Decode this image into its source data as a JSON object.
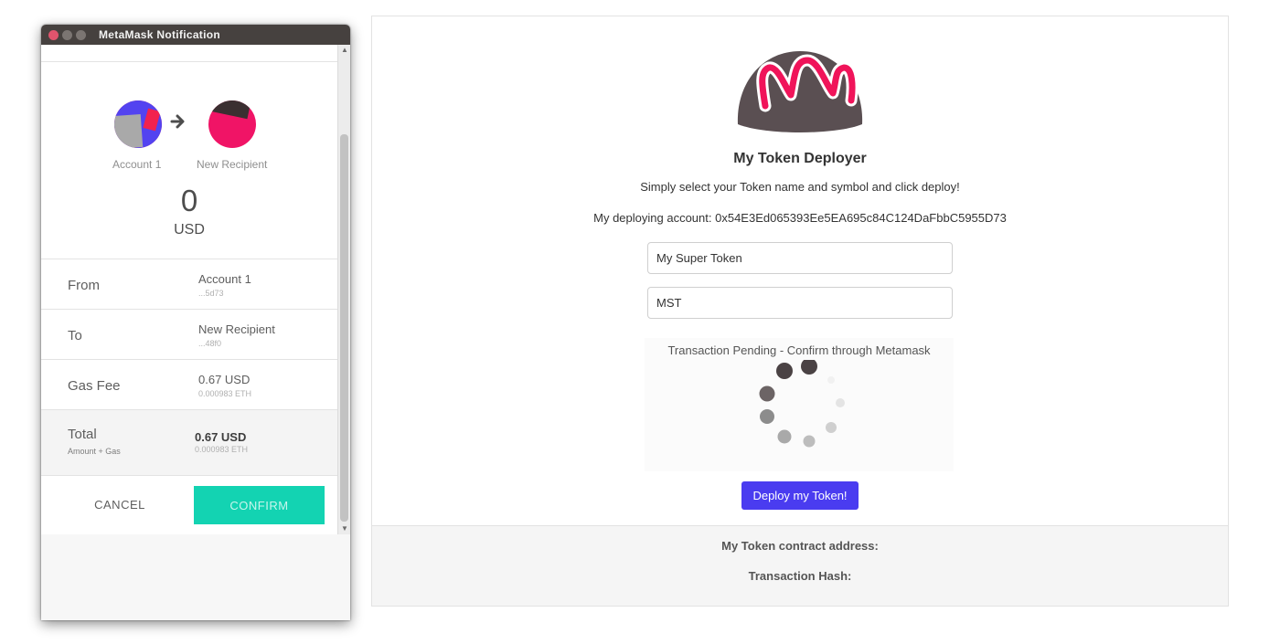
{
  "window": {
    "title": "MetaMask Notification",
    "controls": [
      "close-icon",
      "minimize-icon",
      "maximize-icon"
    ]
  },
  "metamask": {
    "sender_label": "Account 1",
    "recipient_label": "New Recipient",
    "amount_value": "0",
    "amount_unit": "USD",
    "rows": {
      "from": {
        "label": "From",
        "value": "Account 1",
        "sub": "...5d73"
      },
      "to": {
        "label": "To",
        "value": "New Recipient",
        "sub": "...48f0"
      },
      "gas": {
        "label": "Gas Fee",
        "value": "0.67 USD",
        "sub": "0.000983 ETH"
      },
      "total": {
        "label": "Total",
        "sub_label": "Amount + Gas",
        "value": "0.67 USD",
        "sub": "0.000983 ETH"
      }
    },
    "cancel_label": "CANCEL",
    "confirm_label": "CONFIRM",
    "colors": {
      "confirm": "#13d3b2",
      "titlebar": "#46413f"
    }
  },
  "dapp": {
    "logo_icon": "chocolate-token-logo-icon",
    "title": "My Token Deployer",
    "subtitle": "Simply select your Token name and symbol and click deploy!",
    "account_label": "My deploying account:",
    "account_value": "0x54E3Ed065393Ee5EA695c84C124DaFbbC5955D73",
    "token_name_value": "My Super Token",
    "token_symbol_value": "MST",
    "pending_text": "Transaction Pending - Confirm through Metamask",
    "deploy_label": "Deploy my Token!",
    "contract_label": "My Token contract address:",
    "hash_label": "Transaction Hash:",
    "colors": {
      "deploy": "#4a3cf0",
      "logo_body": "#5a4f52",
      "logo_accent": "#f0145a"
    }
  }
}
